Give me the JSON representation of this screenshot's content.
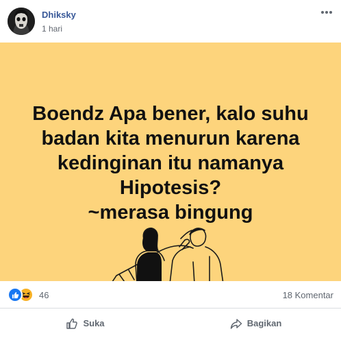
{
  "post": {
    "author": "Dhiksky",
    "time": "1 hari",
    "banner_lines": [
      "Boendz Apa bener, kalo suhu",
      "badan kita menurun karena",
      "kedinginan itu namanya",
      "Hipotesis?",
      "~merasa bingung"
    ],
    "banner_color": "#fdd47c"
  },
  "stats": {
    "reaction_count": "46",
    "comments": "18 Komentar"
  },
  "actions": {
    "like_label": "Suka",
    "share_label": "Bagikan"
  },
  "icons": [
    "more-options-icon",
    "like-reaction-icon",
    "haha-reaction-icon",
    "thumbs-up-icon",
    "share-icon"
  ],
  "accent_colors": {
    "link": "#385898",
    "like_blue": "#1877f2"
  }
}
